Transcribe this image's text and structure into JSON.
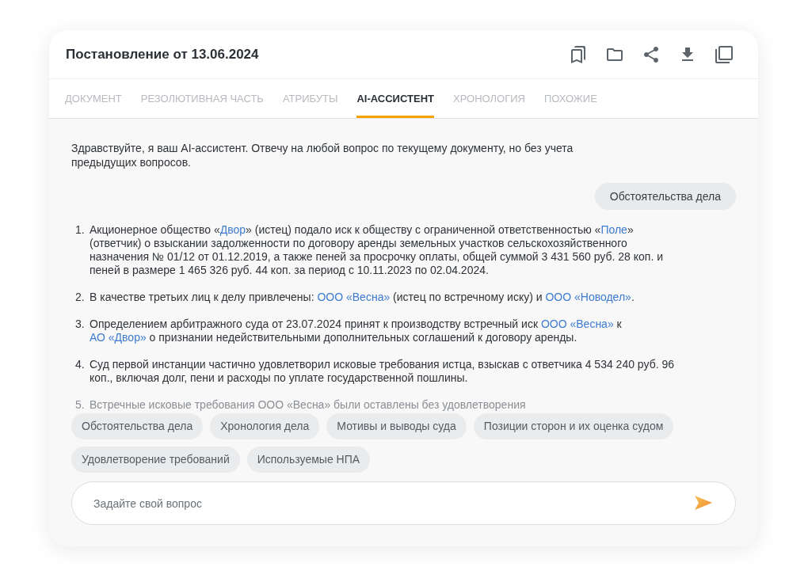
{
  "document": {
    "title": "Постановление от 13.06.2024"
  },
  "tabs": [
    {
      "label": "ДОКУМЕНТ",
      "selected": false
    },
    {
      "label": "РЕЗОЛЮТИВНАЯ ЧАСТЬ",
      "selected": false
    },
    {
      "label": "АТРИБУТЫ",
      "selected": false
    },
    {
      "label": "AI-АССИСТЕНТ",
      "selected": true
    },
    {
      "label": "ХРОНОЛОГИЯ",
      "selected": false
    },
    {
      "label": "ПОХОЖИЕ",
      "selected": false
    }
  ],
  "chat": {
    "greeting": "Здравствуйте, я ваш AI-ассистент. Отвечу на любой вопрос по текущему документу, но без учета предыдущих вопросов.",
    "user_message": "Обстоятельства дела",
    "answer": [
      {
        "number": "1.",
        "faded": false,
        "parts": [
          {
            "kind": "text",
            "text": "Акционерное общество «"
          },
          {
            "kind": "link",
            "text": "Двор"
          },
          {
            "kind": "text",
            "text": "» (истец) подало иск к обществу с ограниченной ответственностью «"
          },
          {
            "kind": "link",
            "text": "Поле"
          },
          {
            "kind": "text",
            "text": "» (ответчик) о взыскании задолженности по договору аренды земельных участков сельскохозяйственного назначения № 01/12 от 01.12.2019, а также пеней за просрочку оплаты, общей суммой 3 431 560 руб. 28 коп. и пеней в размере 1 465 326 руб. 44 коп. за период с 10.11.2023 по 02.04.2024."
          }
        ]
      },
      {
        "number": "2.",
        "faded": false,
        "parts": [
          {
            "kind": "text",
            "text": "В качестве третьих лиц к делу привлечены: "
          },
          {
            "kind": "link",
            "text": "ООО «Весна»"
          },
          {
            "kind": "text",
            "text": " (истец по встречному иску) и "
          },
          {
            "kind": "link",
            "text": "ООО «Новодел»"
          },
          {
            "kind": "text",
            "text": "."
          }
        ]
      },
      {
        "number": "3.",
        "faded": false,
        "parts": [
          {
            "kind": "text",
            "text": "Определением арбитражного суда от 23.07.2024 принят к производству встречный иск "
          },
          {
            "kind": "link",
            "text": "ООО «Весна»"
          },
          {
            "kind": "text",
            "text": " к "
          },
          {
            "kind": "link",
            "text": "АО «Двор»"
          },
          {
            "kind": "text",
            "text": " о признании недействительными дополнительных соглашений к договору аренды."
          }
        ]
      },
      {
        "number": "4.",
        "faded": false,
        "parts": [
          {
            "kind": "text",
            "text": "Суд первой инстанции частично удовлетворил исковые требования истца, взыскав с ответчика 4 534 240 руб. 96 коп., включая долг, пени и расходы по уплате государственной пошлины."
          }
        ]
      },
      {
        "number": "5.",
        "faded": true,
        "parts": [
          {
            "kind": "text",
            "text": "Встречные исковые требования ООО «Весна» были оставлены без удовлетворения"
          }
        ]
      }
    ]
  },
  "suggestions": [
    "Обстоятельства дела",
    "Хронология дела",
    "Мотивы и выводы суда",
    "Позиции сторон и их оценка судом",
    "Удовлетворение требований",
    "Используемые НПА"
  ],
  "question_input": {
    "placeholder": "Задайте свой вопрос"
  }
}
